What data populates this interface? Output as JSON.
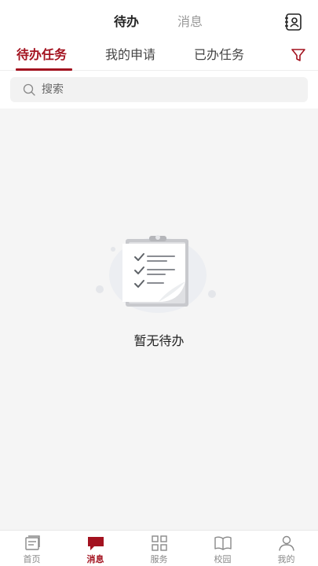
{
  "top_tabs": [
    {
      "label": "待办",
      "active": true
    },
    {
      "label": "消息",
      "active": false
    }
  ],
  "sub_tabs": [
    {
      "label": "待办任务",
      "active": true
    },
    {
      "label": "我的申请",
      "active": false
    },
    {
      "label": "已办任务",
      "active": false
    }
  ],
  "search": {
    "placeholder": "搜索",
    "value": ""
  },
  "empty_state": {
    "text": "暂无待办"
  },
  "bottom_nav": [
    {
      "label": "首页",
      "icon": "home-icon",
      "active": false
    },
    {
      "label": "消息",
      "icon": "message-icon",
      "active": true
    },
    {
      "label": "服务",
      "icon": "services-grid-icon",
      "active": false
    },
    {
      "label": "校园",
      "icon": "campus-book-icon",
      "active": false
    },
    {
      "label": "我的",
      "icon": "profile-icon",
      "active": false
    }
  ],
  "colors": {
    "accent": "#a3121f",
    "background": "#f5f5f5",
    "inactive": "#888888"
  }
}
